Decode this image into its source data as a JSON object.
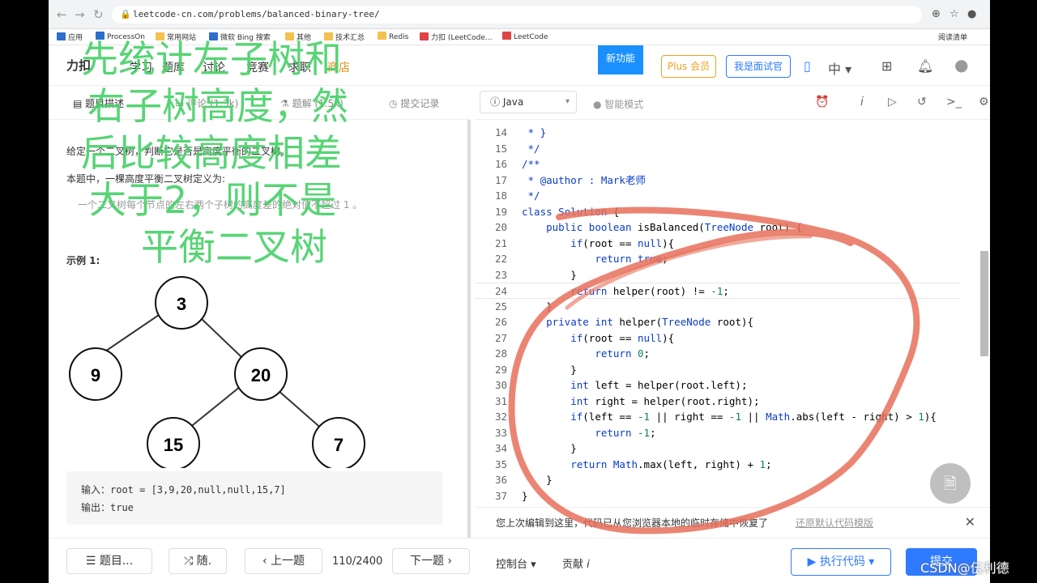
{
  "browser": {
    "url": "leetcode-cn.com/problems/balanced-binary-tree/",
    "bookmarks": [
      "应用",
      "ProcessOn",
      "常用网站",
      "微软 Bing 搜索",
      "其他",
      "技术汇总",
      "Redis",
      "力扣 (LeetCode...",
      "LeetCode"
    ],
    "reading_list": "阅读清单"
  },
  "header": {
    "logo": "力扣",
    "nav": [
      "学习",
      "题库",
      "讨论",
      "竞赛",
      "求职",
      "商店"
    ],
    "new_feature": "新功能",
    "plus": "Plus 会员",
    "interviewer": "我是面试官",
    "lang_switch": "中"
  },
  "left_tabs": [
    "题目描述",
    "评论 (1.3k)",
    "题解 (1.5k)",
    "提交记录"
  ],
  "problem": {
    "p1": "给定一个二叉树，判断它是否是高度平衡的二叉树。",
    "p2": "本题中，一棵高度平衡二叉树定义为:",
    "p3": "一个二叉树每个节点的左右两个子树的高度差的绝对值不超过 1 。",
    "example_title": "示例 1:",
    "tree_nodes": [
      "3",
      "9",
      "20",
      "15",
      "7"
    ],
    "input": "输入：root = [3,9,20,null,null,15,7]",
    "output": "输出：true"
  },
  "editor": {
    "language": "Java",
    "smart_mode": "智能模式",
    "lines": [
      {
        "n": "14",
        "t": " * }"
      },
      {
        "n": "15",
        "t": " */"
      },
      {
        "n": "16",
        "t": "/**"
      },
      {
        "n": "17",
        "t": " * @author : Mark老师"
      },
      {
        "n": "18",
        "t": " */"
      },
      {
        "n": "19",
        "t": "class Solution {"
      },
      {
        "n": "20",
        "t": "    public boolean isBalanced(TreeNode root) {"
      },
      {
        "n": "21",
        "t": "        if(root == null){"
      },
      {
        "n": "22",
        "t": "            return true;"
      },
      {
        "n": "23",
        "t": "        }"
      },
      {
        "n": "24",
        "t": "        return helper(root) != -1;"
      },
      {
        "n": "25",
        "t": "    }"
      },
      {
        "n": "26",
        "t": "    private int helper(TreeNode root){"
      },
      {
        "n": "27",
        "t": "        if(root == null){"
      },
      {
        "n": "28",
        "t": "            return 0;"
      },
      {
        "n": "29",
        "t": "        }"
      },
      {
        "n": "30",
        "t": "        int left = helper(root.left);"
      },
      {
        "n": "31",
        "t": "        int right = helper(root.right);"
      },
      {
        "n": "32",
        "t": "        if(left == -1 || right == -1 || Math.abs(left - right) > 1){"
      },
      {
        "n": "33",
        "t": "            return -1;"
      },
      {
        "n": "34",
        "t": "        }"
      },
      {
        "n": "35",
        "t": "        return Math.max(left, right) + 1;"
      },
      {
        "n": "36",
        "t": "    }"
      },
      {
        "n": "37",
        "t": "}"
      }
    ]
  },
  "notice": {
    "text": "您上次编辑到这里，代码已从您浏览器本地的临时存储中恢复了",
    "link": "还原默认代码模版"
  },
  "bottom": {
    "problems": "题目...",
    "random": "随.",
    "prev": "上一题",
    "page": "110/2400",
    "next": "下一题",
    "console": "控制台",
    "contribute": "贡献",
    "run": "执行代码",
    "submit": "提交"
  },
  "annotation": [
    "先统计左子树和",
    "右子树高度，然",
    "后比较高度相差",
    "大于2，则不是",
    "平衡二叉树"
  ],
  "watermark": "CSDN@伍利德",
  "colors": {
    "annotation": "#49d16a",
    "circle": "#e8705a",
    "accent": "#2f7bff"
  }
}
